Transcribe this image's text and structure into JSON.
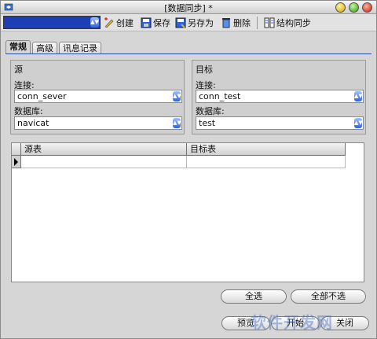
{
  "window": {
    "title": "[数据同步] *"
  },
  "toolbar": {
    "new_label": "创建",
    "save_label": "保存",
    "save_as_label": "另存为",
    "delete_label": "删除",
    "structure_sync_label": "结构同步"
  },
  "tabs": [
    {
      "label": "常规",
      "active": true
    },
    {
      "label": "高级",
      "active": false
    },
    {
      "label": "讯息记录",
      "active": false
    }
  ],
  "source": {
    "title": "源",
    "connection_label": "连接:",
    "connection_value": "conn_sever",
    "database_label": "数据库:",
    "database_value": "navicat"
  },
  "target": {
    "title": "目标",
    "connection_label": "连接:",
    "connection_value": "conn_test",
    "database_label": "数据库:",
    "database_value": "test"
  },
  "grid": {
    "columns": [
      "源表",
      "目标表"
    ],
    "rows": [
      [
        "",
        ""
      ]
    ]
  },
  "buttons": {
    "select_all": "全选",
    "deselect_all": "全部不选",
    "preview": "预览",
    "start": "开始",
    "close": "关闭"
  },
  "watermark": "软件开发网",
  "colors": {
    "accent": "#2f62d8",
    "profile_select": "#1c3fb5"
  }
}
